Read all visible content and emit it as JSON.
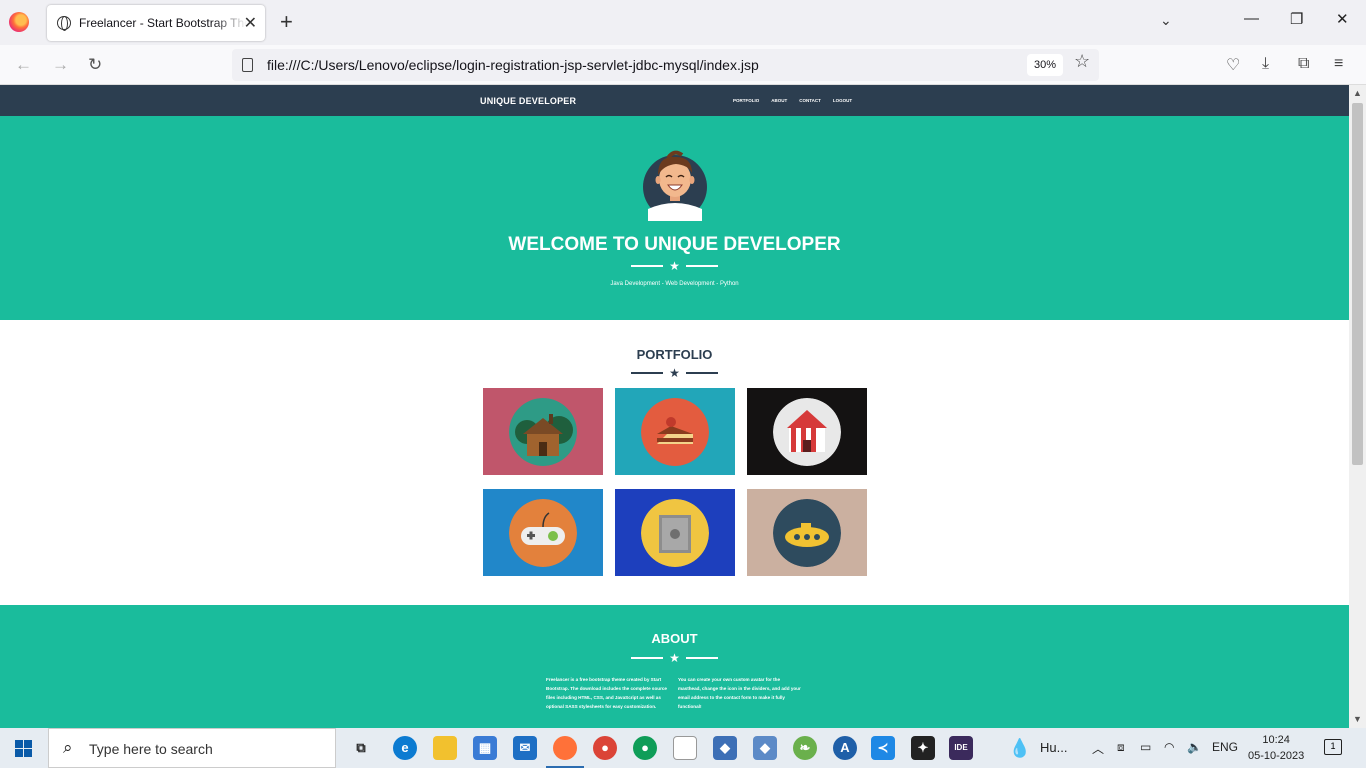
{
  "browser": {
    "tab_title": "Freelancer - Start Bootstrap Theme",
    "url": "file:///C:/Users/Lenovo/eclipse/login-registration-jsp-servlet-jdbc-mysql/index.jsp",
    "zoom": "30%"
  },
  "site": {
    "brand": "UNIQUE DEVELOPER",
    "nav": [
      "PORTFOLIO",
      "ABOUT",
      "CONTACT",
      "LOGOUT"
    ],
    "masthead": {
      "title": "WELCOME TO UNIQUE DEVELOPER",
      "subtitle": "Java Development - Web Development - Python"
    },
    "portfolio": {
      "title": "PORTFOLIO",
      "items": [
        {
          "name": "cabin",
          "bg": "#c0566b",
          "circle": "#2e9b86"
        },
        {
          "name": "cake",
          "bg": "#22a6b9",
          "circle": "#e35c3f"
        },
        {
          "name": "circus",
          "bg": "#141212",
          "circle": "#e8e8e8"
        },
        {
          "name": "game",
          "bg": "#2187c9",
          "circle": "#e3813c"
        },
        {
          "name": "safe",
          "bg": "#1d3fbd",
          "circle": "#f0c541"
        },
        {
          "name": "submarine",
          "bg": "#cbb0a0",
          "circle": "#2e4b5e"
        }
      ]
    },
    "about": {
      "title": "ABOUT",
      "col1": "Freelancer is a free bootstrap theme created by Start Bootstrap. The download includes the complete source files including HTML, CSS, and JavaScript as well as optional SASS stylesheets for easy customization.",
      "col2": "You can create your own custom avatar for the masthead, change the icon in the dividers, and add your email address to the contact form to make it fully functional!"
    },
    "colors": {
      "primary": "#1abc9c",
      "dark": "#2c3e50"
    }
  },
  "taskbar": {
    "search_placeholder": "Type here to search",
    "weather": "Hu...",
    "lang": "ENG",
    "time": "10:24",
    "date": "05-10-2023",
    "notifications": "1"
  }
}
